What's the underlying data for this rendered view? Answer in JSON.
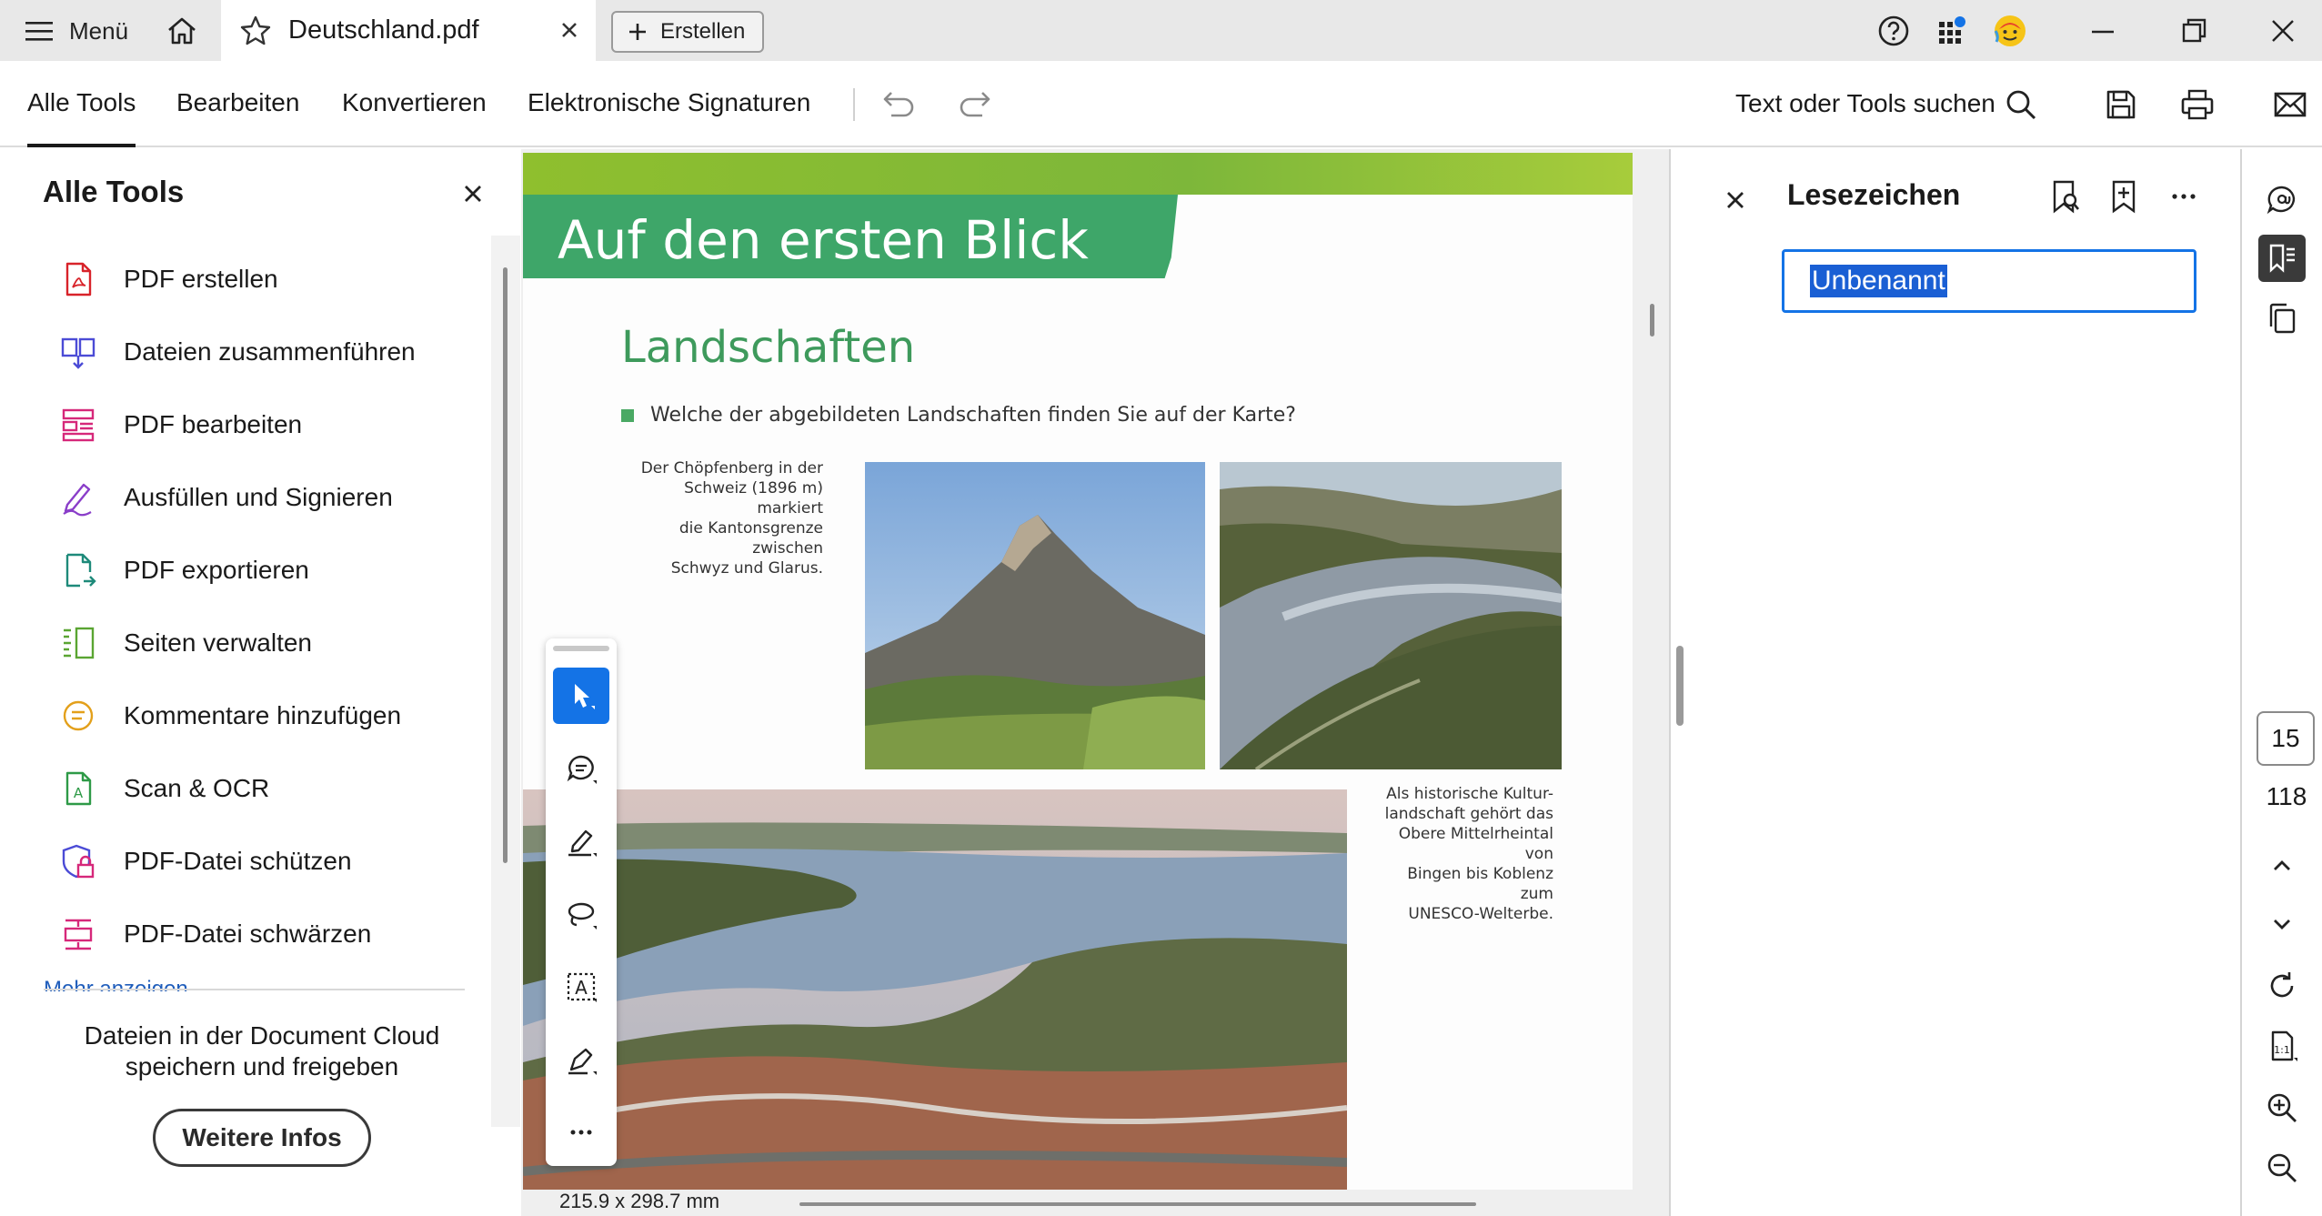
{
  "titlebar": {
    "menu_label": "Menü",
    "tab_title": "Deutschland.pdf",
    "create_label": "Erstellen"
  },
  "toolbar": {
    "items": [
      "Alle Tools",
      "Bearbeiten",
      "Konvertieren",
      "Elektronische Signaturen"
    ],
    "search_label": "Text oder Tools suchen"
  },
  "left_panel": {
    "title": "Alle Tools",
    "items": [
      {
        "label": "PDF erstellen",
        "icon": "pdf-create-icon",
        "color": "#d8232a"
      },
      {
        "label": "Dateien zusammenführen",
        "icon": "combine-files-icon",
        "color": "#4b4bd6"
      },
      {
        "label": "PDF bearbeiten",
        "icon": "edit-pdf-icon",
        "color": "#d6287a"
      },
      {
        "label": "Ausfüllen und Signieren",
        "icon": "fill-sign-icon",
        "color": "#8a3ec9"
      },
      {
        "label": "PDF exportieren",
        "icon": "export-pdf-icon",
        "color": "#1e8a7a"
      },
      {
        "label": "Seiten verwalten",
        "icon": "organize-pages-icon",
        "color": "#5aa532"
      },
      {
        "label": "Kommentare hinzufügen",
        "icon": "comment-icon",
        "color": "#e3a01b"
      },
      {
        "label": "Scan & OCR",
        "icon": "scan-ocr-icon",
        "color": "#2e9a47"
      },
      {
        "label": "PDF-Datei schützen",
        "icon": "protect-pdf-icon",
        "color": "#4b4bd6"
      },
      {
        "label": "PDF-Datei schwärzen",
        "icon": "redact-pdf-icon",
        "color": "#d6287a"
      }
    ],
    "more_label": "Mehr anzeigen",
    "cloud_text_1": "Dateien in der Document Cloud",
    "cloud_text_2": "speichern und freigeben",
    "info_button": "Weitere Infos"
  },
  "document": {
    "banner_title": "Auf den ersten Blick",
    "heading": "Landschaften",
    "question": "Welche der abgebildeten Landschaften finden Sie auf der Karte?",
    "caption_1": [
      "Der Chöpfenberg in der",
      "Schweiz (1896 m) markiert",
      "die Kantonsgrenze zwischen",
      "Schwyz und Glarus."
    ],
    "caption_2": [
      "Als historische Kultur-",
      "landschaft gehört das",
      "Obere Mittelrheintal von",
      "Bingen bis Koblenz zum",
      "UNESCO-Welterbe."
    ],
    "page_size": "215.9 x 298.7 mm"
  },
  "bookmarks": {
    "title": "Lesezeichen",
    "entry": "Unbenannt"
  },
  "navigation": {
    "current_page": "15",
    "total_pages": "118"
  },
  "colors": {
    "accent": "#1473e6",
    "banner_green": "#3ea669",
    "heading_green": "#3e9a5c"
  }
}
